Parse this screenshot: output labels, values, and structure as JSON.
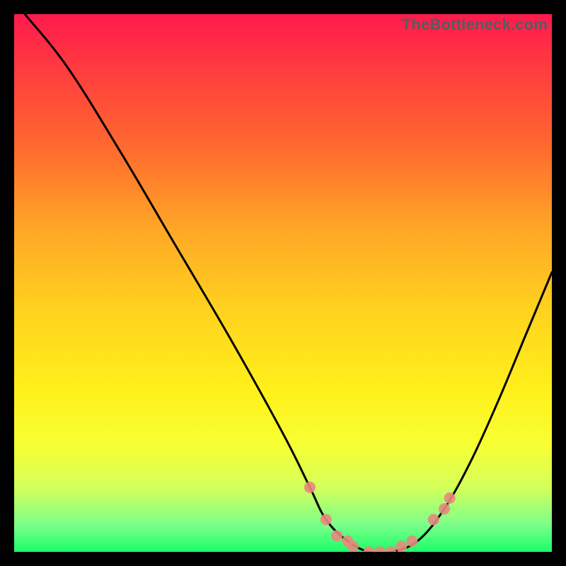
{
  "watermark": "TheBottleneck.com",
  "chart_data": {
    "type": "line",
    "title": "",
    "xlabel": "",
    "ylabel": "",
    "xlim": [
      0,
      100
    ],
    "ylim": [
      0,
      100
    ],
    "series": [
      {
        "name": "bottleneck-curve",
        "x": [
          2,
          10,
          20,
          30,
          40,
          50,
          55,
          58,
          62,
          66,
          70,
          75,
          80,
          85,
          90,
          95,
          100
        ],
        "y": [
          100,
          90,
          74,
          57,
          40,
          22,
          12,
          6,
          2,
          0,
          0,
          2,
          8,
          17,
          28,
          40,
          52
        ]
      }
    ],
    "markers": {
      "name": "highlight-points",
      "x": [
        55,
        58,
        60,
        62,
        63,
        66,
        68,
        70,
        72,
        74,
        78,
        80,
        81
      ],
      "y": [
        12,
        6,
        3,
        2,
        1,
        0,
        0,
        0,
        1,
        2,
        6,
        8,
        10
      ]
    },
    "gradient_stops": [
      {
        "pos": 0.0,
        "color": "#ff1a4d"
      },
      {
        "pos": 0.1,
        "color": "#ff3b3f"
      },
      {
        "pos": 0.25,
        "color": "#ff6a2f"
      },
      {
        "pos": 0.4,
        "color": "#ffa726"
      },
      {
        "pos": 0.55,
        "color": "#ffd21f"
      },
      {
        "pos": 0.7,
        "color": "#fff01a"
      },
      {
        "pos": 0.8,
        "color": "#f7ff33"
      },
      {
        "pos": 0.88,
        "color": "#d4ff5a"
      },
      {
        "pos": 0.95,
        "color": "#7bff8a"
      },
      {
        "pos": 1.0,
        "color": "#1aff66"
      }
    ]
  }
}
